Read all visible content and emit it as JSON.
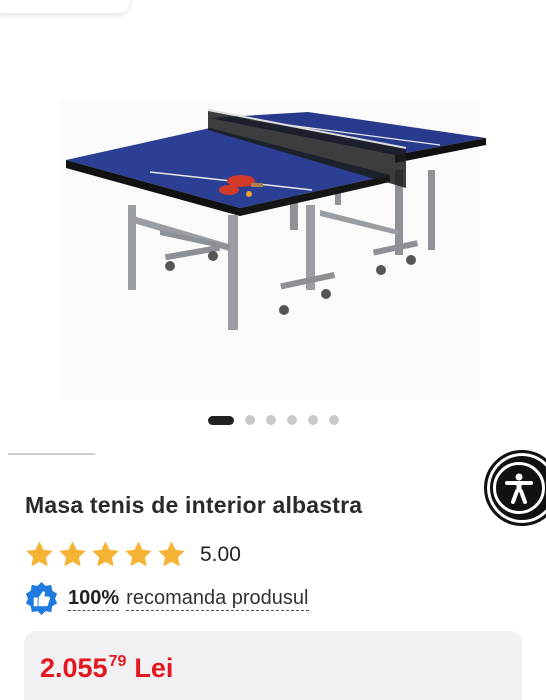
{
  "gallery": {
    "image_alt": "ping-pong-table-image",
    "slide_count": 6,
    "active_slide": 1
  },
  "accessibility": {
    "icon": "accessibility-icon"
  },
  "product": {
    "title": "Masa tenis de interior albastra",
    "rating": {
      "value": "5.00",
      "stars": 5,
      "star_color": "#f5b335"
    },
    "recommend": {
      "percent": "100%",
      "text": "recomanda produsul",
      "badge_icon": "thumbs-up-badge-icon",
      "badge_color": "#1f7ae0"
    },
    "price": {
      "main": "2.055",
      "decimals": "79",
      "currency": "Lei",
      "color": "#e3171f"
    }
  }
}
